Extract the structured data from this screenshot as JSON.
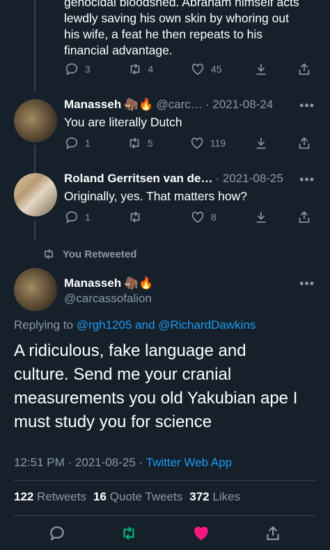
{
  "top_tweet": {
    "text_lines": [
      "genocidal bloodshed. Abraham himself acts",
      "lewdly saving his own skin by whoring out",
      "his wife, a feat he then repeats to his",
      "financial advantage."
    ],
    "replies": "3",
    "retweets": "4",
    "likes": "45"
  },
  "reply1": {
    "name": "Manasseh",
    "emojis": "🦣🔥",
    "handle": "@carc…",
    "date": "· 2021-08-24",
    "text": "You are literally Dutch",
    "replies": "1",
    "retweets": "5",
    "likes": "119"
  },
  "reply2": {
    "name": "Roland Gerritsen van de…",
    "date": "· 2021-08-25",
    "text": "Originally, yes. That matters how?",
    "replies": "1",
    "retweets": "",
    "likes": "8"
  },
  "retweet_banner": "You Retweeted",
  "main": {
    "name": "Manasseh",
    "emojis": "🦣🔥",
    "handle": "@carcassofalion",
    "replying_prefix": "Replying to ",
    "replying_user1": "@rgh1205",
    "replying_and": " and ",
    "replying_user2": "@RichardDawkins",
    "text_lines": [
      "A ridiculous, fake language and",
      "culture. Send me your cranial",
      "measurements you old Yakubian ape I",
      "must study you for science"
    ],
    "time": "12:51 PM · 2021-08-25 · ",
    "source": "Twitter Web App",
    "retweet_count": "122",
    "retweet_label": "Retweets",
    "quote_count": "16",
    "quote_label": "Quote Tweets",
    "like_count": "372",
    "like_label": "Likes"
  },
  "more_icon": "•••",
  "colors": {
    "background": "#15202b",
    "muted": "#8b98a5",
    "link": "#1d9bf0",
    "retweeted": "#00ba7c",
    "liked": "#f91880"
  }
}
